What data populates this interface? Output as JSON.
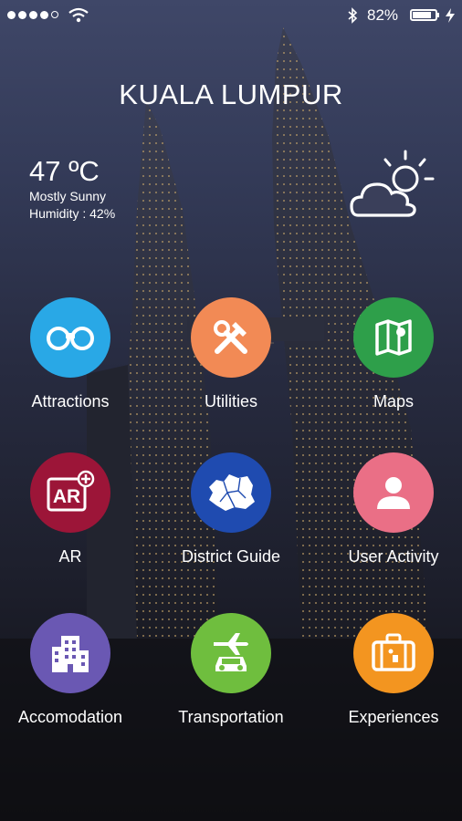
{
  "status_bar": {
    "battery_text": "82%",
    "battery_level": 0.82,
    "signal_bars": 4,
    "icons": [
      "signal-dots-icon",
      "wifi-icon",
      "bluetooth-icon",
      "battery-icon",
      "charging-bolt-icon"
    ]
  },
  "header": {
    "city": "KUALA LUMPUR"
  },
  "weather": {
    "temperature": "47 ºC",
    "condition": "Mostly Sunny",
    "humidity": "Humidity : 42%",
    "icon": "partly-sunny-icon"
  },
  "grid": [
    {
      "label": "Attractions",
      "icon": "binoculars-icon",
      "color": "#29a8e6"
    },
    {
      "label": "Utilities",
      "icon": "tools-icon",
      "color": "#f28a55"
    },
    {
      "label": "Maps",
      "icon": "map-icon",
      "color": "#2e9f4a"
    },
    {
      "label": "AR",
      "icon": "ar-plus-icon",
      "color": "#9c1538"
    },
    {
      "label": "District Guide",
      "icon": "district-map-icon",
      "color": "#1f4bb0"
    },
    {
      "label": "User Activity",
      "icon": "user-icon",
      "color": "#ea6f86"
    },
    {
      "label": "Accomodation",
      "icon": "building-icon",
      "color": "#6a58b3"
    },
    {
      "label": "Transportation",
      "icon": "plane-car-icon",
      "color": "#6fbe3e"
    },
    {
      "label": "Experiences",
      "icon": "suitcase-icon",
      "color": "#f39520"
    }
  ]
}
